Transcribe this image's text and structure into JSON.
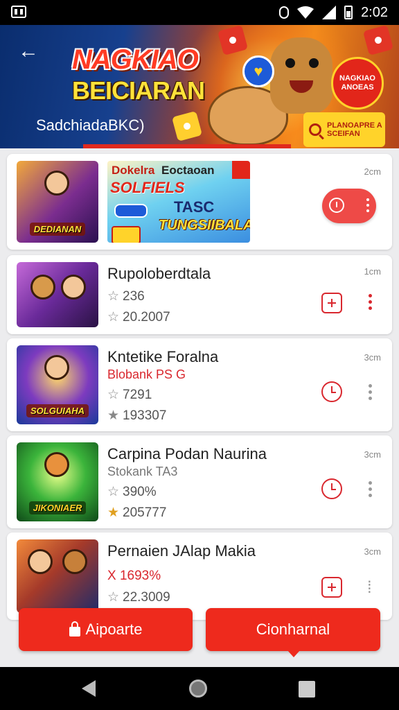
{
  "status_bar": {
    "time": "2:02"
  },
  "banner": {
    "title": "NAGKIAO",
    "subtitle": "BEICIARAN",
    "tagline": "SadchiadaBKC)",
    "badge_text": "NAGKIAO ANOEAS",
    "search_tag_text": "PLANOAPRE A SCEIFAN"
  },
  "items": [
    {
      "thumb_label": "DEDIANAN",
      "promo": {
        "line1": "Dokelra",
        "line2": "Eoctaoan",
        "line3": "SOLFIELS",
        "line4": "TASC",
        "line5": "TUNGSIIBALA"
      },
      "time": "2cm",
      "icon": "toggle-icon"
    },
    {
      "title": "Rupoloberdtala",
      "stat1": "236",
      "stat2": "20.2007",
      "time": "1cm",
      "icon": "add-box-icon"
    },
    {
      "title": "Kntetike Foralna",
      "subtitle": "Blobank PS G",
      "stat1": "7291",
      "stat2": "193307",
      "thumb_label": "SOLGUIAHA",
      "time": "3cm",
      "icon": "clock-icon"
    },
    {
      "title": "Carpina Podan Naurina",
      "subtitle": "Stokank TA3",
      "stat1": "390%",
      "stat2": "205777",
      "thumb_label": "JIKONIAER",
      "time": "3cm",
      "icon": "clock-icon"
    },
    {
      "title": "Pernaien JAlap Makia",
      "stat1": "X 1693%",
      "stat2": "22.3009",
      "time": "3cm",
      "icon": "add-box-icon"
    }
  ],
  "buttons": {
    "left_label": "Aipoarte",
    "right_label": "Cionharnal"
  },
  "colors": {
    "accent": "#ee2a1d",
    "icon_red": "#d9272e"
  }
}
